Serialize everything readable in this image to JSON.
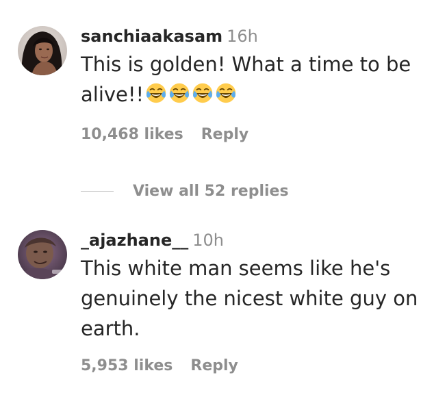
{
  "comments": [
    {
      "username": "sanchiaakasam",
      "time": "16h",
      "text": "This is golden! What a time to be alive!!",
      "emojis": [
        "face-with-tears-of-joy",
        "face-with-tears-of-joy",
        "face-with-tears-of-joy",
        "face-with-tears-of-joy"
      ],
      "likes": "10,468 likes",
      "reply": "Reply"
    },
    {
      "username": "_ajazhane__",
      "time": "10h",
      "text": "This white man seems like he's genuinely the nicest white guy on earth.",
      "likes": "5,953 likes",
      "reply": "Reply"
    }
  ],
  "view_replies": "View all 52 replies",
  "colors": {
    "text": "#262626",
    "secondary": "#8e8e8e",
    "divider": "#c7c7c7",
    "emoji_face": "#FFCC4D",
    "emoji_tears": "#5DADEC"
  }
}
